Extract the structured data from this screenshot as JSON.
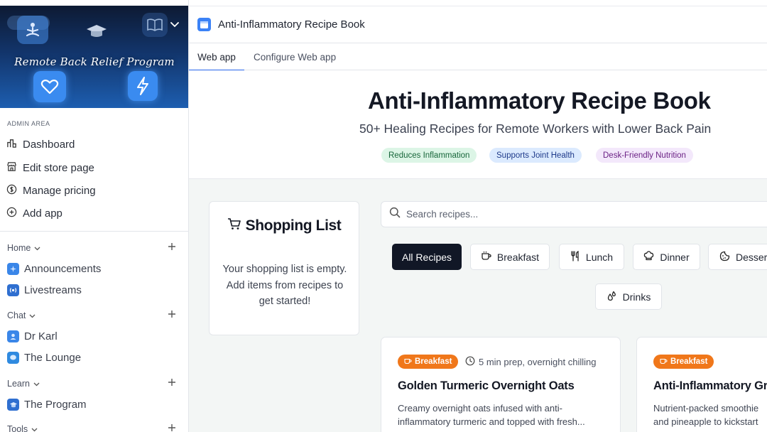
{
  "sidebar": {
    "banner_title": "Remote Back Relief Program",
    "admin_label": "ADMIN AREA",
    "admin_items": [
      {
        "label": "Dashboard",
        "icon": "chart-icon"
      },
      {
        "label": "Edit store page",
        "icon": "store-icon"
      },
      {
        "label": "Manage pricing",
        "icon": "dollar-icon"
      },
      {
        "label": "Add app",
        "icon": "plus-circle-icon"
      }
    ],
    "sections": [
      {
        "label": "Home",
        "items": [
          "Announcements",
          "Livestreams"
        ]
      },
      {
        "label": "Chat",
        "items": [
          "Dr Karl",
          "The Lounge"
        ]
      },
      {
        "label": "Learn",
        "items": [
          "The Program"
        ]
      },
      {
        "label": "Tools",
        "items": []
      }
    ]
  },
  "header": {
    "app_title": "Anti-Inflammatory Recipe Book",
    "tabs": [
      "Web app",
      "Configure Web app"
    ]
  },
  "hero": {
    "title": "Anti-Inflammatory Recipe Book",
    "subtitle": "50+ Healing Recipes for Remote Workers with Lower Back Pain",
    "pills": [
      {
        "label": "Reduces Inflammation",
        "bg": "#dcf5e6",
        "fg": "#17663a"
      },
      {
        "label": "Supports Joint Health",
        "bg": "#dbeafe",
        "fg": "#1e3a8a"
      },
      {
        "label": "Desk-Friendly Nutrition",
        "bg": "#f3e8fb",
        "fg": "#6b2185"
      }
    ]
  },
  "shopping_list": {
    "title": "Shopping List",
    "empty_text": "Your shopping list is empty. Add items from recipes to get started!"
  },
  "search": {
    "placeholder": "Search recipes..."
  },
  "filters": [
    {
      "label": "All Recipes",
      "icon": "",
      "active": true
    },
    {
      "label": "Breakfast",
      "icon": "coffee-icon",
      "active": false
    },
    {
      "label": "Lunch",
      "icon": "utensils-icon",
      "active": false
    },
    {
      "label": "Dinner",
      "icon": "chef-hat-icon",
      "active": false
    },
    {
      "label": "Desser",
      "icon": "cookie-icon",
      "active": false
    },
    {
      "label": "Drinks",
      "icon": "droplets-icon",
      "active": false
    }
  ],
  "recipes": [
    {
      "category": "Breakfast",
      "time": "5 min prep, overnight chilling",
      "title": "Golden Turmeric Overnight Oats",
      "description": "Creamy overnight oats infused with anti-inflammatory turmeric and topped with fresh..."
    },
    {
      "category": "Breakfast",
      "time": "",
      "title": "Anti-Inflammatory Gr",
      "description": "Nutrient-packed smoothie and pineapple to kickstart"
    }
  ],
  "colors": {
    "accent": "#2563eb",
    "badge": "#f0771a",
    "active_filter": "#111726"
  }
}
